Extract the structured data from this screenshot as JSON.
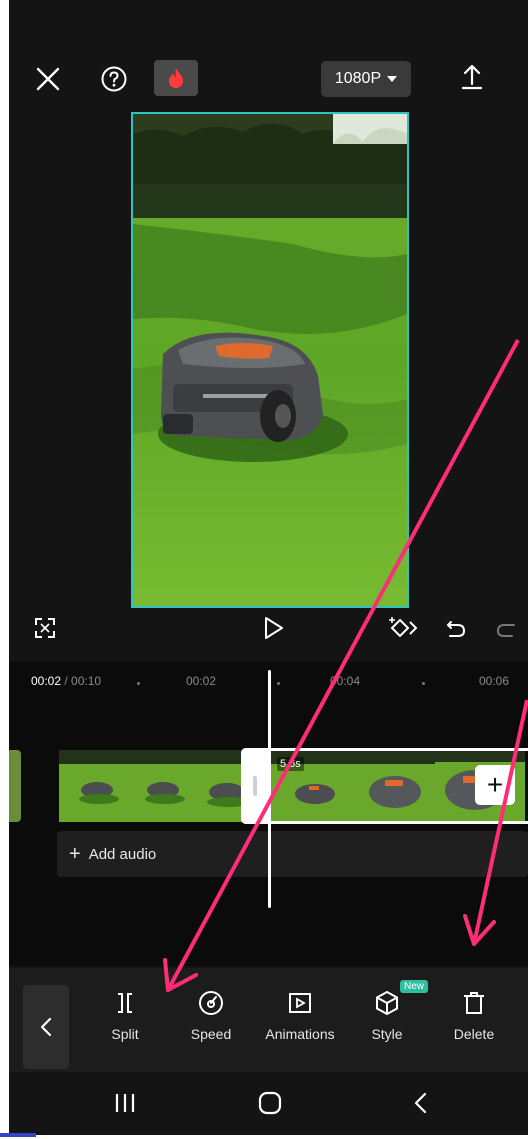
{
  "header": {
    "resolution": "1080P"
  },
  "timeline": {
    "current_time": "00:02",
    "total_time": "/ 00:10",
    "ticks": [
      "00:02",
      "00:04",
      "00:06"
    ],
    "clip_duration": "5.6s",
    "add_audio_label": "Add audio"
  },
  "toolbar": {
    "items": [
      {
        "label": "Split",
        "icon": "split-icon"
      },
      {
        "label": "Speed",
        "icon": "speed-icon"
      },
      {
        "label": "Animations",
        "icon": "animations-icon"
      },
      {
        "label": "Style",
        "icon": "style-icon"
      },
      {
        "label": "Delete",
        "icon": "delete-icon"
      }
    ],
    "new_badge": "New"
  },
  "colors": {
    "accent": "#2fc4c0",
    "arrow": "#ff2d78",
    "badge": "#2fbf9f"
  }
}
